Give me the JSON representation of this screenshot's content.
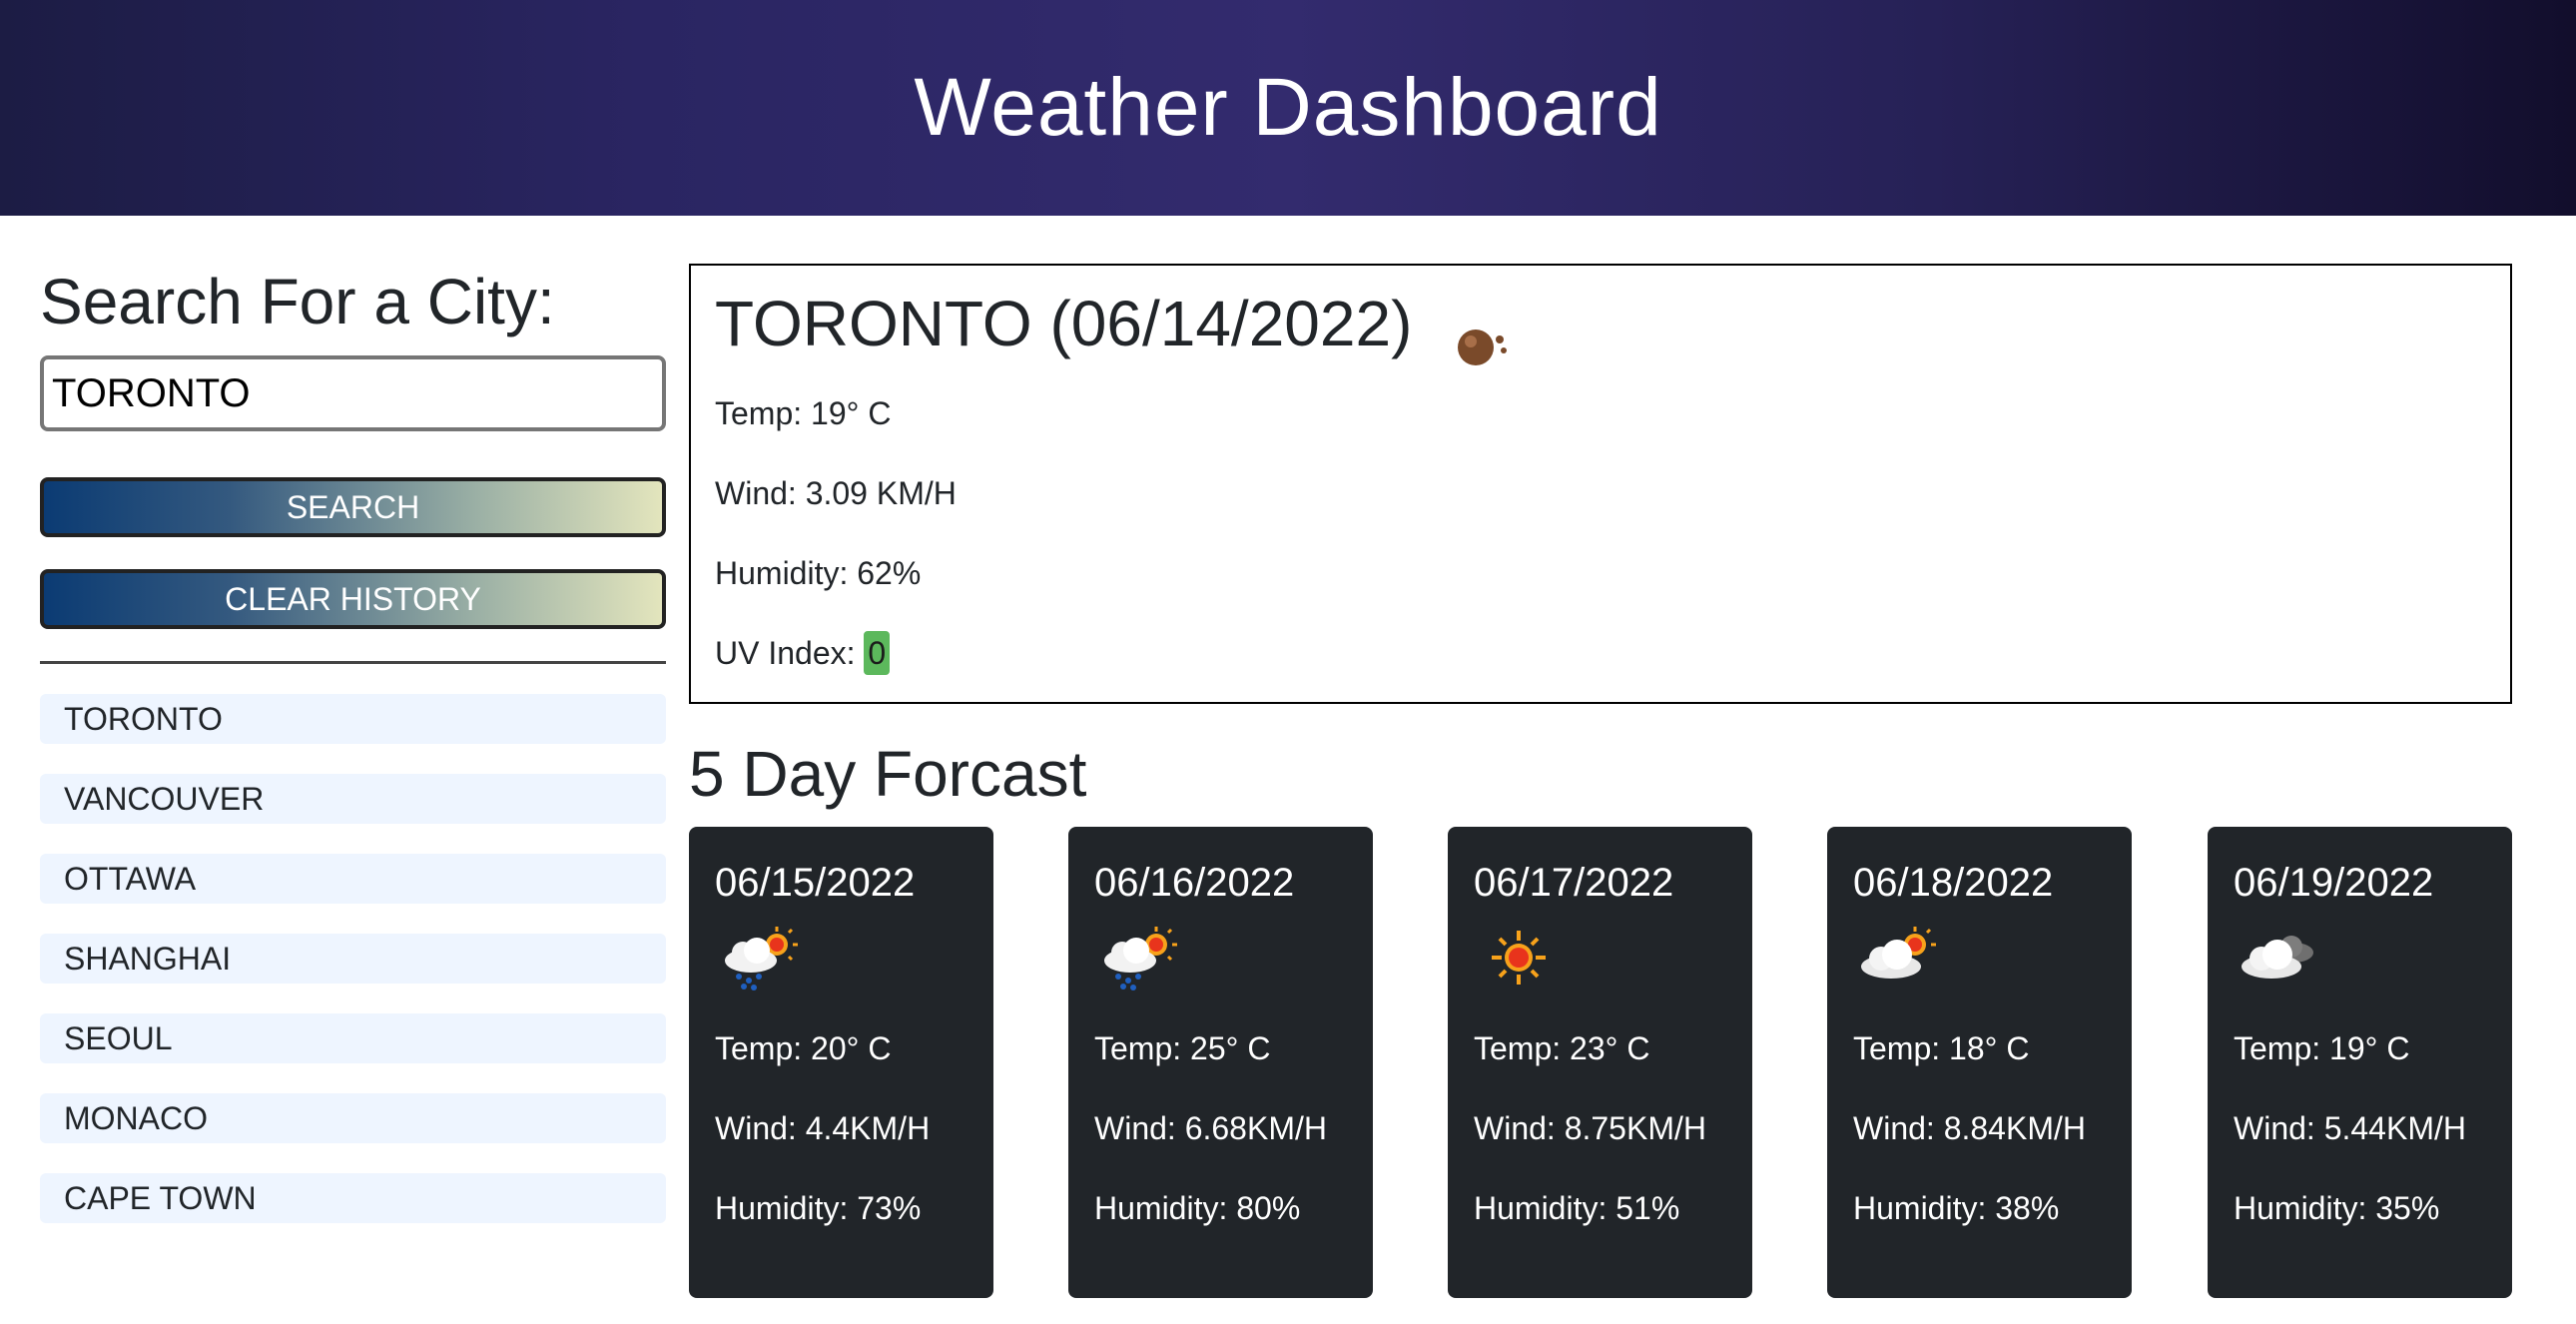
{
  "header": {
    "title": "Weather Dashboard"
  },
  "sidebar": {
    "heading": "Search For a City:",
    "search_value": "TORONTO",
    "search_button": "SEARCH",
    "clear_button": "CLEAR HISTORY",
    "history": [
      "TORONTO",
      "VANCOUVER",
      "OTTAWA",
      "SHANGHAI",
      "SEOUL",
      "MONACO",
      "CAPE TOWN"
    ]
  },
  "current": {
    "title": "TORONTO (06/14/2022)",
    "icon": "brown-dot-icon",
    "temp": "Temp: 19° C",
    "wind": "Wind: 3.09 KM/H",
    "humidity": "Humidity: 62%",
    "uv_label": "UV Index:",
    "uv_value": "0",
    "uv_color": "#5cb85c"
  },
  "forecast": {
    "title": "5 Day Forcast",
    "days": [
      {
        "date": "06/15/2022",
        "icon": "rain-sun-icon",
        "temp": "Temp: 20° C",
        "wind": "Wind: 4.4KM/H",
        "humidity": "Humidity: 73%"
      },
      {
        "date": "06/16/2022",
        "icon": "rain-sun-icon",
        "temp": "Temp: 25° C",
        "wind": "Wind: 6.68KM/H",
        "humidity": "Humidity: 80%"
      },
      {
        "date": "06/17/2022",
        "icon": "sun-icon",
        "temp": "Temp: 23° C",
        "wind": "Wind: 8.75KM/H",
        "humidity": "Humidity: 51%"
      },
      {
        "date": "06/18/2022",
        "icon": "cloud-sun-icon",
        "temp": "Temp: 18° C",
        "wind": "Wind: 8.84KM/H",
        "humidity": "Humidity: 38%"
      },
      {
        "date": "06/19/2022",
        "icon": "clouds-icon",
        "temp": "Temp: 19° C",
        "wind": "Wind: 5.44KM/H",
        "humidity": "Humidity: 35%"
      }
    ]
  }
}
